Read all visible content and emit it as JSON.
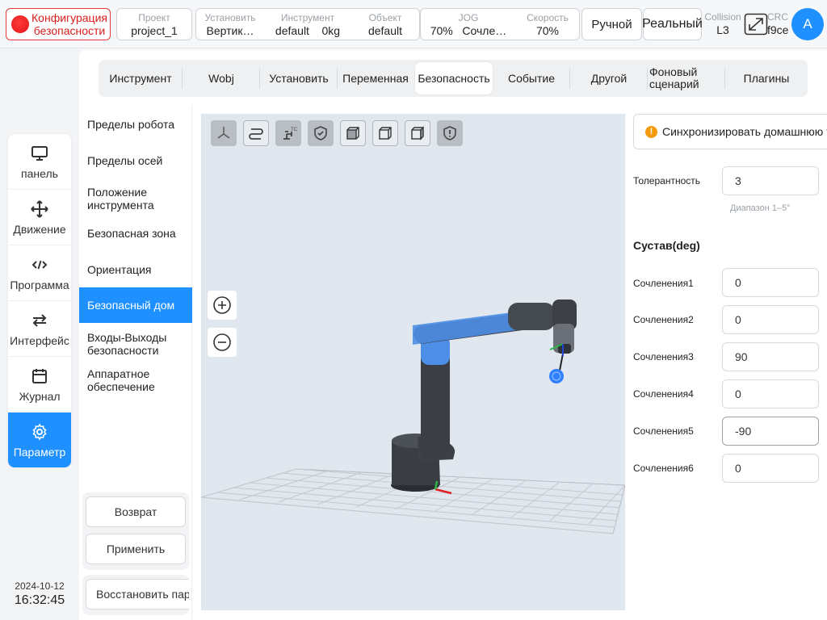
{
  "topbar": {
    "safety_config": "Конфигурация безопасности",
    "project": {
      "label": "Проект",
      "value": "project_1"
    },
    "install": {
      "label": "Установить",
      "value": "Вертик…"
    },
    "tool": {
      "label": "Инструмент",
      "value": "default",
      "payload": "0kg"
    },
    "object": {
      "label": "Объект",
      "value": "default"
    },
    "jog": {
      "label": "JOG",
      "value": "70%",
      "mode": "Сочле…"
    },
    "speed": {
      "label": "Скорость",
      "value": "70%"
    },
    "manual_label": "Ручной",
    "real_label": "Реальный",
    "collision": {
      "label": "Collision",
      "value": "L3"
    },
    "crc": {
      "label": "CRC",
      "value": "f9ce"
    },
    "avatar_letter": "A"
  },
  "leftnav": {
    "items": [
      {
        "label": "панель",
        "icon": "monitor-icon"
      },
      {
        "label": "Движение",
        "icon": "move-icon"
      },
      {
        "label": "Программа",
        "icon": "code-icon"
      },
      {
        "label": "Интерфейс",
        "icon": "swap-icon"
      },
      {
        "label": "Журнал",
        "icon": "calendar-icon"
      },
      {
        "label": "Параметр",
        "icon": "gear-icon",
        "active": true
      }
    ]
  },
  "datetime": {
    "date": "2024-10-12",
    "time": "16:32:45"
  },
  "tabs": [
    {
      "label": "Инструмент"
    },
    {
      "label": "Wobj"
    },
    {
      "label": "Установить"
    },
    {
      "label": "Переменная"
    },
    {
      "label": "Безопасность",
      "active": true
    },
    {
      "label": "Событие"
    },
    {
      "label": "Другой"
    },
    {
      "label": "Фоновый сценарий"
    },
    {
      "label": "Плагины"
    }
  ],
  "submenu": {
    "items": [
      {
        "label": "Пределы робота"
      },
      {
        "label": "Пределы осей"
      },
      {
        "label": "Положение инструмента"
      },
      {
        "label": "Безопасная зона"
      },
      {
        "label": "Ориентация"
      },
      {
        "label": "Безопасный дом",
        "active": true
      },
      {
        "label": "Входы-Выходы безопасности"
      },
      {
        "label": "Аппаратное обеспечение"
      }
    ],
    "return_label": "Возврат",
    "apply_label": "Применить",
    "restore_label": "Восстановить параметры"
  },
  "viewport": {
    "tools": [
      "axes-icon",
      "path-icon",
      "robot-icon",
      "shield-check-icon",
      "cube-front-icon",
      "cube-iso-icon",
      "cube-side-icon",
      "shield-alert-icon"
    ]
  },
  "right": {
    "sync_label": "Синхронизировать домашнюю точку",
    "tolerance_label": "Толерантность",
    "tolerance_value": "3",
    "range_hint": "Диапазон 1–5°",
    "section_title": "Сустав(deg)",
    "joints": [
      {
        "label": "Сочленения1",
        "value": "0"
      },
      {
        "label": "Сочленения2",
        "value": "0"
      },
      {
        "label": "Сочленения3",
        "value": "90"
      },
      {
        "label": "Сочленения4",
        "value": "0"
      },
      {
        "label": "Сочленения5",
        "value": "-90"
      },
      {
        "label": "Сочленения6",
        "value": "0"
      }
    ]
  },
  "colors": {
    "accent": "#1e90ff",
    "danger": "#e11414",
    "warning": "#f59a0c"
  }
}
